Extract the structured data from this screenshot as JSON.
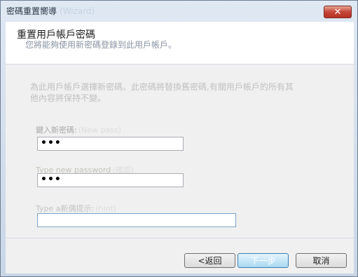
{
  "window": {
    "title": "密碼重置嚮導",
    "title_faded": "(Wizard)",
    "close_symbol": "✕"
  },
  "header": {
    "title": "重置用戶帳戶密碼",
    "subtitle": "您將能夠使用新密碼登錄到此用戶帳戶。"
  },
  "body": {
    "instruction": "為此用戶帳戶選擇新密碼。此密碼將替換舊密碼,有關用戶帳戶的所有其他內容將保持不變。",
    "new_password": {
      "label": "鍵入新密碼:",
      "label_faded": "(New pass)",
      "value": "•••"
    },
    "confirm_password": {
      "label": "Type new password",
      "label_faded": "(確認)",
      "value": "•••"
    },
    "hint": {
      "label": "Type a新偶提示:",
      "label_faded": "(hint)",
      "value": ""
    }
  },
  "footer": {
    "back_label": "<返回",
    "next_label": "下一步",
    "cancel_label": "取消"
  }
}
